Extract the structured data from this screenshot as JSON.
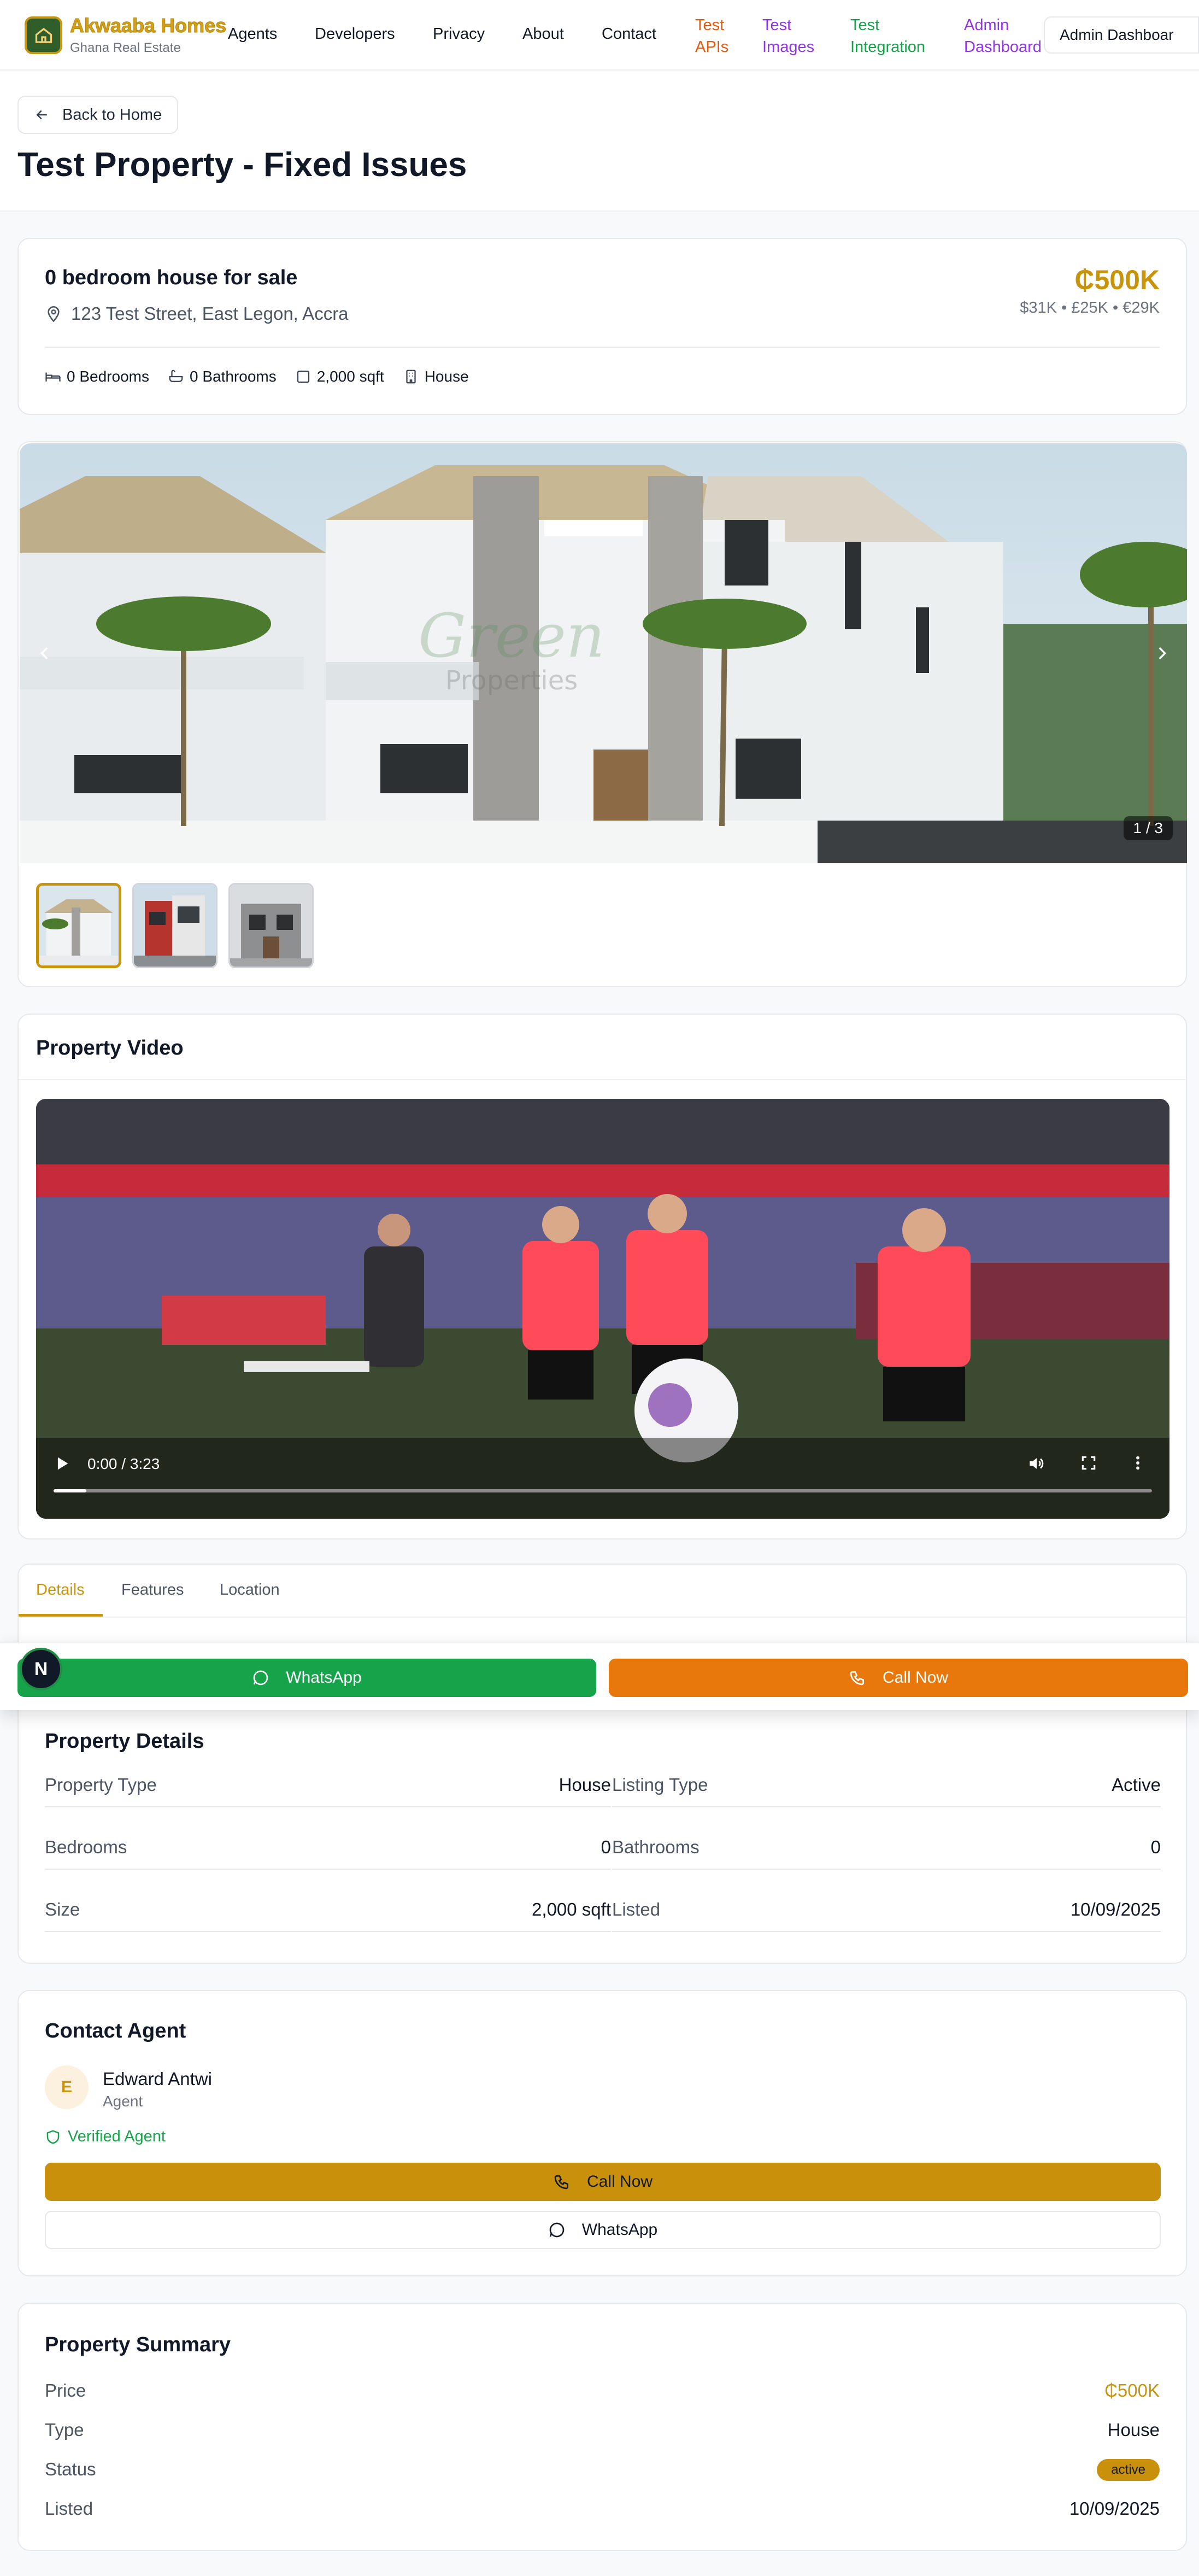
{
  "brand": {
    "name": "Akwaaba Homes",
    "subtitle": "Ghana Real Estate",
    "accent": "#c8940b"
  },
  "nav": {
    "links": [
      "Agents",
      "Developers",
      "Privacy",
      "About",
      "Contact"
    ],
    "test_apis": [
      "Test",
      "APIs"
    ],
    "test_images": [
      "Test",
      "Images"
    ],
    "test_integration": [
      "Test",
      "Integration"
    ],
    "admin_dashboard": [
      "Admin",
      "Dashboard"
    ],
    "admin_button": "Admin Dashboar"
  },
  "page": {
    "back_label": "Back to Home",
    "title": "Test Property - Fixed Issues"
  },
  "property": {
    "heading": "0 bedroom house for sale",
    "address": "123 Test Street, East Legon, Accra",
    "price": "₵500K",
    "price_conversions": "$31K • £25K • €29K",
    "specs": {
      "bedrooms": "0 Bedrooms",
      "bathrooms": "0 Bathrooms",
      "size": "2,000 sqft",
      "type": "House"
    }
  },
  "gallery": {
    "counter": "1 / 3",
    "watermark_line1": "Green",
    "watermark_line2": "Properties"
  },
  "video": {
    "title": "Property Video",
    "time": "0:00 / 3:23"
  },
  "tabs": [
    "Details",
    "Features",
    "Location"
  ],
  "actions": {
    "whatsapp": "WhatsApp",
    "call": "Call Now",
    "badge": "N"
  },
  "details": {
    "title": "Property Details",
    "rows": [
      {
        "label": "Property Type",
        "value": "House"
      },
      {
        "label": "Listing Type",
        "value": "Active"
      },
      {
        "label": "Bedrooms",
        "value": "0"
      },
      {
        "label": "Bathrooms",
        "value": "0"
      },
      {
        "label": "Size",
        "value": "2,000 sqft"
      },
      {
        "label": "Listed",
        "value": "10/09/2025"
      }
    ]
  },
  "contact": {
    "title": "Contact Agent",
    "initial": "E",
    "name": "Edward Antwi",
    "role": "Agent",
    "verified": "Verified Agent",
    "call": "Call Now",
    "whatsapp": "WhatsApp"
  },
  "summary": {
    "title": "Property Summary",
    "price_label": "Price",
    "price_value": "₵500K",
    "type_label": "Type",
    "type_value": "House",
    "status_label": "Status",
    "status_value": "active",
    "listed_label": "Listed",
    "listed_value": "10/09/2025"
  }
}
